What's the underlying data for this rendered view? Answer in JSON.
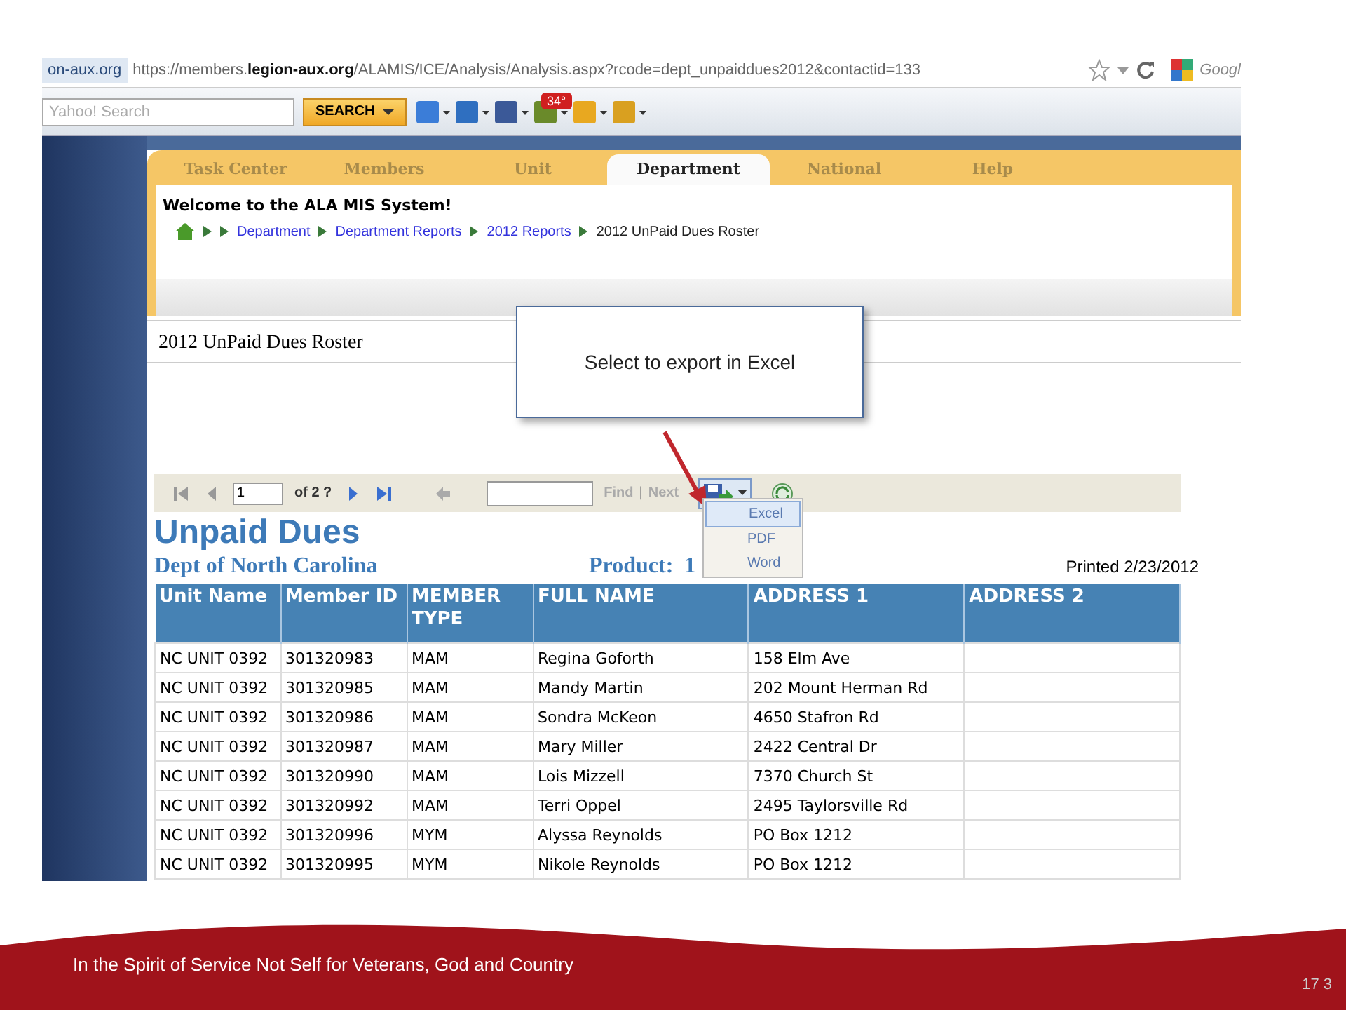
{
  "browser": {
    "tab_label": "on-aux.org",
    "url": "https://members.**legion-aux.org**/ALAMIS/ICE/Analysis/Analysis.aspx?rcode=dept_unpaiddues2012&contactid=133",
    "search_engine": "Googl",
    "search": {
      "placeholder": "Yahoo! Search"
    },
    "search_button": "SEARCH",
    "weather_badge": "34°"
  },
  "tabs": [
    {
      "label": "Task Center",
      "selected": false
    },
    {
      "label": "Members",
      "selected": false
    },
    {
      "label": "Unit",
      "selected": false
    },
    {
      "label": "Department",
      "selected": true
    },
    {
      "label": "National",
      "selected": false
    },
    {
      "label": "Help",
      "selected": false
    }
  ],
  "welcome": "Welcome to the ALA MIS System!",
  "breadcrumb": [
    {
      "label": "Department",
      "link": true
    },
    {
      "label": "Department Reports",
      "link": true
    },
    {
      "label": "2012 Reports",
      "link": true
    },
    {
      "label": "2012 UnPaid Dues Roster",
      "link": false
    }
  ],
  "page_title": "2012 UnPaid Dues Roster",
  "callout": "Select to export in Excel",
  "report_toolbar": {
    "page": "1",
    "of_pages": "of 2 ?",
    "find": "Find",
    "separator": "|",
    "next": "Next"
  },
  "export_menu": [
    {
      "label": "Excel",
      "selected": true
    },
    {
      "label": "PDF",
      "selected": false
    },
    {
      "label": "Word",
      "selected": false
    }
  ],
  "report": {
    "title": "Unpaid Dues",
    "subtitle": "Dept of North Carolina",
    "product": "Product:  1",
    "printed": "Printed 2/23/2012"
  },
  "table": {
    "columns": [
      "Unit Name",
      "Member ID",
      "MEMBER TYPE",
      "FULL NAME",
      "ADDRESS 1",
      "ADDRESS 2"
    ],
    "rows": [
      [
        "NC UNIT 0392",
        "301320983",
        "MAM",
        "Regina Goforth",
        "158 Elm Ave",
        ""
      ],
      [
        "NC UNIT 0392",
        "301320985",
        "MAM",
        "Mandy Martin",
        "202 Mount Herman Rd",
        ""
      ],
      [
        "NC UNIT 0392",
        "301320986",
        "MAM",
        "Sondra McKeon",
        "4650 Stafron Rd",
        ""
      ],
      [
        "NC UNIT 0392",
        "301320987",
        "MAM",
        "Mary Miller",
        "2422 Central Dr",
        ""
      ],
      [
        "NC UNIT 0392",
        "301320990",
        "MAM",
        "Lois Mizzell",
        "7370 Church St",
        ""
      ],
      [
        "NC UNIT 0392",
        "301320992",
        "MAM",
        "Terri Oppel",
        "2495 Taylorsville Rd",
        ""
      ],
      [
        "NC UNIT 0392",
        "301320996",
        "MYM",
        "Alyssa Reynolds",
        "PO Box 1212",
        ""
      ],
      [
        "NC UNIT 0392",
        "301320995",
        "MYM",
        "Nikole Reynolds",
        "PO Box 1212",
        ""
      ]
    ]
  },
  "footer": {
    "motto": "In the Spirit of Service Not Self  for Veterans, God and Country",
    "page_number": "17 3"
  }
}
